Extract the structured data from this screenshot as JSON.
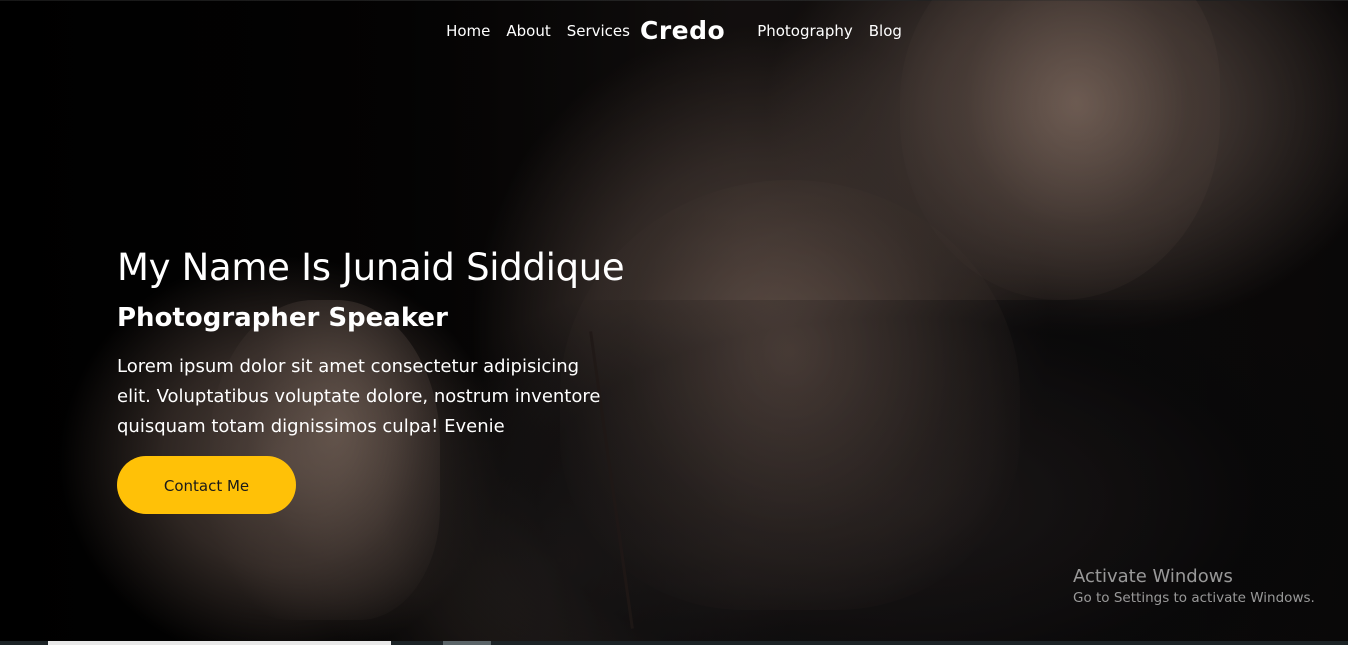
{
  "nav": {
    "brand": "Credo",
    "left_items": [
      {
        "label": "Home"
      },
      {
        "label": "About"
      },
      {
        "label": "Services"
      }
    ],
    "right_items": [
      {
        "label": "Photography"
      },
      {
        "label": "Blog"
      }
    ]
  },
  "hero": {
    "title": "My Name Is Junaid Siddique",
    "subtitle": "Photographer Speaker",
    "description": "Lorem ipsum dolor sit amet consectetur adipisicing elit. Voluptatibus voluptate dolore, nostrum inventore quisquam totam dignissimos culpa! Evenie",
    "cta_label": "Contact Me"
  },
  "watermark": {
    "title": "Activate Windows",
    "subtitle": "Go to Settings to activate Windows."
  },
  "colors": {
    "accent": "#ffc107",
    "text": "#ffffff",
    "background": "#000000"
  }
}
